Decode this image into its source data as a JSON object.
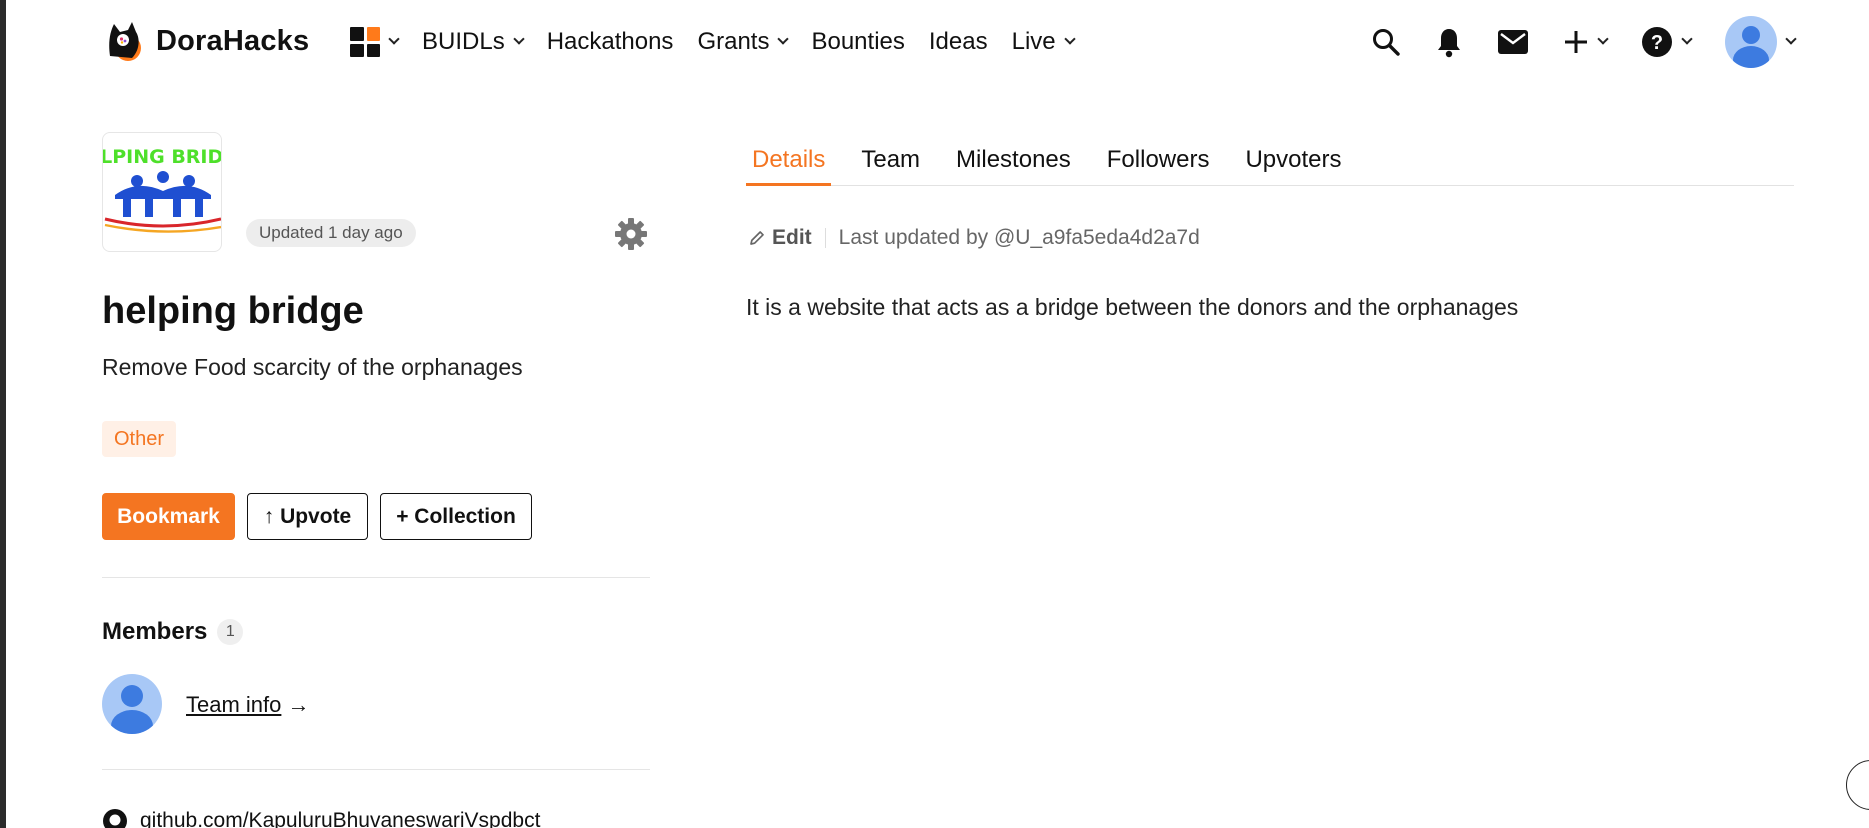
{
  "brand": {
    "name": "DoraHacks",
    "accent": "#f47521"
  },
  "nav": {
    "apps_icon": "apps-grid-icon",
    "items": [
      {
        "label": "BUIDLs",
        "has_dropdown": true
      },
      {
        "label": "Hackathons",
        "has_dropdown": false
      },
      {
        "label": "Grants",
        "has_dropdown": true
      },
      {
        "label": "Bounties",
        "has_dropdown": false
      },
      {
        "label": "Ideas",
        "has_dropdown": false
      },
      {
        "label": "Live",
        "has_dropdown": true
      }
    ]
  },
  "toolbar": {
    "icons": [
      "search-icon",
      "bell-icon",
      "mail-icon",
      "plus-icon",
      "help-icon",
      "avatar"
    ]
  },
  "project": {
    "logo_text": "ELPING BRIDG",
    "updated": "Updated 1 day ago",
    "title": "helping bridge",
    "subtitle": "Remove Food scarcity of the orphanages",
    "tag": "Other",
    "buttons": {
      "bookmark": "Bookmark",
      "upvote": "↑ Upvote",
      "collection": "+ Collection"
    },
    "members_title": "Members",
    "members_count": "1",
    "team_info": "Team info",
    "team_info_arrow": "→",
    "github": "github.com/KapuluruBhuvaneswariVspdbct"
  },
  "tabs": [
    {
      "label": "Details",
      "active": true
    },
    {
      "label": "Team",
      "active": false
    },
    {
      "label": "Milestones",
      "active": false
    },
    {
      "label": "Followers",
      "active": false
    },
    {
      "label": "Upvoters",
      "active": false
    }
  ],
  "details": {
    "edit_label": "Edit",
    "last_updated": "Last updated by @U_a9fa5eda4d2a7d",
    "description": "It is a website that acts as a bridge between the donors and the orphanages"
  }
}
